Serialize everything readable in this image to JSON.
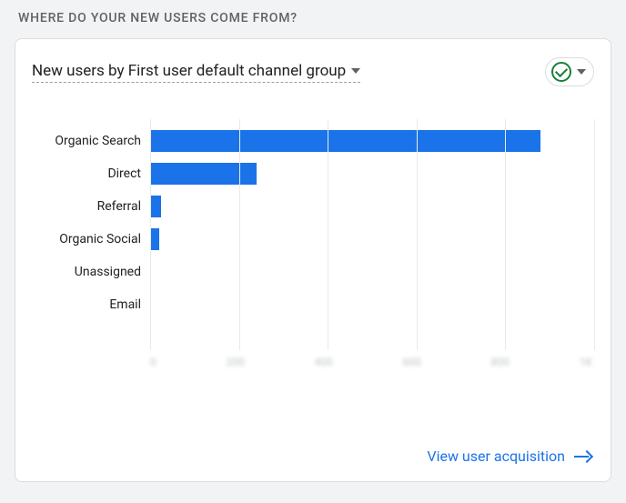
{
  "section_title": "WHERE DO YOUR NEW USERS COME FROM?",
  "dropdown_label": "New users by First user default channel group",
  "footer_link": "View user acquisition",
  "status_icon": "check-circle",
  "chart_data": {
    "type": "bar",
    "orientation": "horizontal",
    "categories": [
      "Organic Search",
      "Direct",
      "Referral",
      "Organic Social",
      "Unassigned",
      "Email"
    ],
    "values": [
      880,
      240,
      25,
      20,
      0,
      0
    ],
    "x_ticks": [
      0,
      200,
      400,
      600,
      800,
      1000
    ],
    "x_tick_labels": [
      "0",
      "200",
      "400",
      "600",
      "800",
      "1K"
    ],
    "xlim": [
      0,
      1000
    ],
    "ylabel": "",
    "xlabel": "",
    "title": "",
    "bar_color": "#1a73e8"
  }
}
